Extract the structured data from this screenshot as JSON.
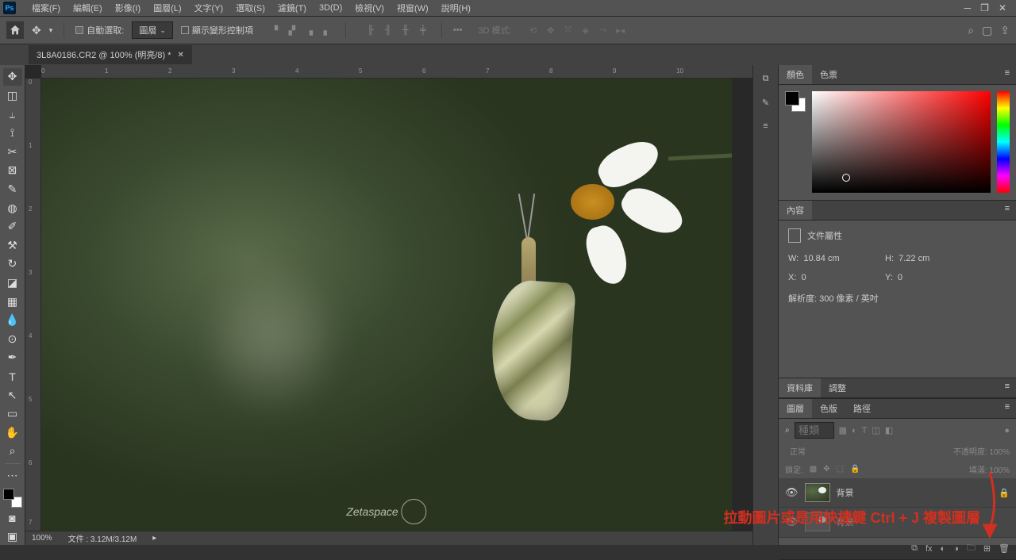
{
  "menubar": {
    "items": [
      "檔案(F)",
      "編輯(E)",
      "影像(I)",
      "圖層(L)",
      "文字(Y)",
      "選取(S)",
      "濾鏡(T)",
      "3D(D)",
      "檢視(V)",
      "視窗(W)",
      "說明(H)"
    ]
  },
  "options_bar": {
    "auto_select_label": "自動選取:",
    "auto_select_target": "圖層",
    "show_transform_label": "顯示變形控制項",
    "mode_3d_label": "3D 模式:"
  },
  "document_tab": {
    "title": "3L8A0186.CR2 @ 100% (明亮/8) *"
  },
  "status_bar": {
    "zoom": "100%",
    "doc_info": "文件 : 3.12M/3.12M"
  },
  "color_panel": {
    "tab1": "顏色",
    "tab2": "色票"
  },
  "properties_panel": {
    "tab": "內容",
    "title": "文件屬性",
    "w_label": "W:",
    "w_value": "10.84 cm",
    "h_label": "H:",
    "h_value": "7.22 cm",
    "x_label": "X:",
    "x_value": "0",
    "y_label": "Y:",
    "y_value": "0",
    "resolution": "解析度: 300 像素 / 英吋"
  },
  "library_panel": {
    "tab1": "資料庫",
    "tab2": "調整"
  },
  "layers_panel": {
    "tab1": "圖層",
    "tab2": "色版",
    "tab3": "路徑",
    "filter_placeholder": "種類",
    "blend_mode": "正常",
    "opacity_label": "不透明度:",
    "opacity_value": "100%",
    "lock_label": "鎖定:",
    "fill_label": "填滿:",
    "fill_value": "100%",
    "layer1_name": "背景",
    "layer2_name": "背景"
  },
  "annotation": {
    "text": "拉動圖片或是用快捷鍵 Ctrl + J 複製圖層"
  },
  "watermark": "Zetaspace"
}
